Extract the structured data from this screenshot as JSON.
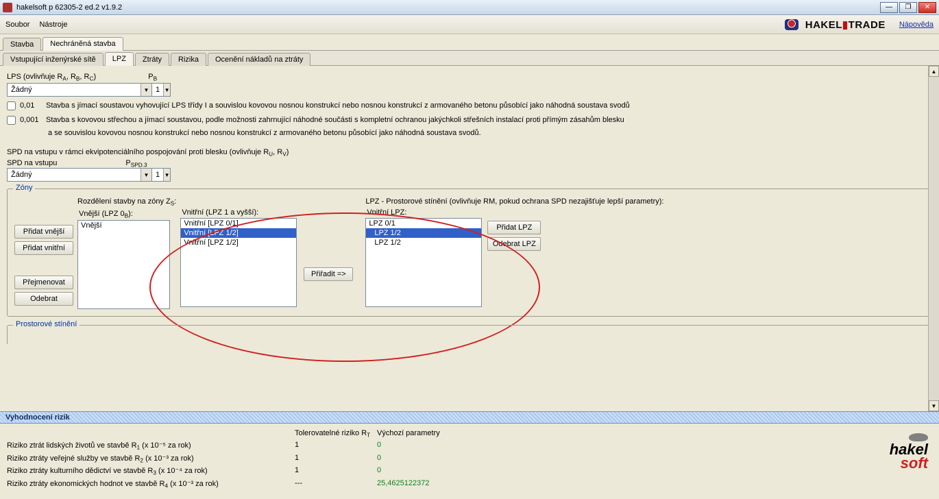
{
  "title": "hakelsoft p 62305-2 ed.2 v1.9.2",
  "menu": {
    "soubor": "Soubor",
    "nastroje": "Nástroje",
    "napoveda": "Nápověda"
  },
  "brand": "HAKEL TRADE",
  "tabs": {
    "stavba": "Stavba",
    "nechr": "Nechráněná stavba"
  },
  "subtabs": {
    "site": "Vstupující inženýrské sítě",
    "lpz": "LPZ",
    "ztraty": "Ztráty",
    "rizika": "Rizika",
    "oceneni": "Ocenění nákladů na ztráty"
  },
  "lps": {
    "label": "LPS (ovlivňuje R",
    "label_suff": ")",
    "pb": "P",
    "pb_sub": "B",
    "dropdown_value": "Žádný",
    "dropdown_num": "1",
    "chk1_num": "0,01",
    "chk1_text": "Stavba s jímací soustavou vyhovující LPS třídy I a souvislou kovovou nosnou konstrukcí nebo nosnou konstrukcí z armovaného betonu působící jako náhodná soustava svodů",
    "chk2_num": "0,001",
    "chk2_text": "Stavba s kovovou střechou a jímací soustavou, podle možnosti zahrnující náhodné součásti s kompletní ochranou jakýchkoli střešních instalací proti přímým zásahům blesku",
    "chk2_cont": "a se souvislou kovovou nosnou konstrukcí nebo nosnou konstrukcí z armovaného betonu působící jako náhodná soustava svodů."
  },
  "spd": {
    "line1": "SPD na vstupu v rámci ekvipotenciálního pospojování proti blesku (ovlivňuje R",
    "line1_suf": ")",
    "label": "SPD na vstupu",
    "pspd": "P",
    "pspd_sub": "SPD.3",
    "dropdown_value": "Žádný",
    "dropdown_num": "1"
  },
  "zones": {
    "legend": "Zóny",
    "caption": "Rozdělení stavby na zóny Z",
    "vnejsi_label": "Vnější (LPZ 0",
    "vnejsi_suff": "):",
    "vnitrni_label": "Vnitřní (LPZ 1 a vyšší):",
    "btn_add_outer": "Přidat vnější",
    "btn_add_inner": "Přidat vnitřní",
    "btn_rename": "Přejmenovat",
    "btn_remove": "Odebrat",
    "outer_items": [
      "Vnější"
    ],
    "inner_items": [
      "Vnitřní [LPZ 0/1]",
      "Vnitřní [LPZ 1/2]",
      "Vnitřní [LPZ 1/2]"
    ],
    "inner_selected": 1,
    "btn_assign": "Přiřadit =>",
    "lpz_caption": "LPZ - Prostorové stínění (ovlivňuje RM, pokud ochrana SPD nezajišťuje lepší parametry):",
    "lpz_label": "Vnitřní LPZ:",
    "lpz_items": [
      "LPZ 0/1",
      "LPZ 1/2",
      "LPZ 1/2"
    ],
    "lpz_selected": 1,
    "btn_add_lpz": "Přidat LPZ",
    "btn_rem_lpz": "Odebrat LPZ"
  },
  "shield": {
    "legend": "Prostorové stínění"
  },
  "eval": {
    "title": "Vyhodnocení rizik",
    "col_tol": "Tolerovatelné riziko R",
    "col_def": "Výchozí parametry",
    "rows": [
      {
        "label": "Riziko ztrát lidských životů ve stavbě R",
        "sub": "1",
        "exp": "(x 10⁻⁵ za rok)",
        "tol": "1",
        "def": "0"
      },
      {
        "label": "Riziko ztráty veřejné služby ve stavbě R",
        "sub": "2",
        "exp": "(x 10⁻³ za rok)",
        "tol": "1",
        "def": "0"
      },
      {
        "label": "Riziko ztráty kulturního dědictví ve stavbě R",
        "sub": "3",
        "exp": "(x 10⁻⁴ za rok)",
        "tol": "1",
        "def": "0"
      },
      {
        "label": "Riziko ztráty ekonomických hodnot ve stavbě R",
        "sub": "4",
        "exp": "(x 10⁻³ za rok)",
        "tol": "---",
        "def": "25,4625122372"
      }
    ]
  }
}
